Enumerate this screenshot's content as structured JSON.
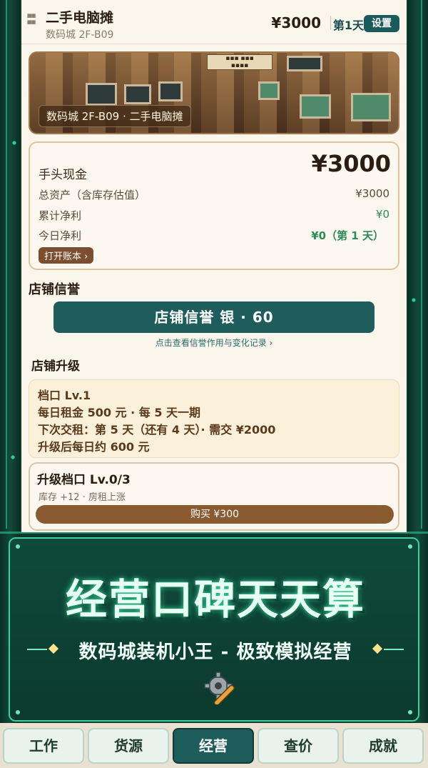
{
  "header": {
    "title": "二手电脑摊",
    "location": "数码城 2F-B09",
    "cash": "¥3000",
    "day": "第1天",
    "settings_label": "设置"
  },
  "banner": {
    "caption": "数码城 2F-B09 · 二手电脑摊"
  },
  "finance": {
    "cash_label": "手头现金",
    "cash_value": "¥3000",
    "total_assets_label": "总资产（含库存估值）",
    "total_assets_value": "¥3000",
    "cumulative_profit_label": "累计净利",
    "cumulative_profit_value": "¥0",
    "today_profit_label": "今日净利",
    "today_profit_value": "¥0（第 1 天）",
    "ledger_button": "打开账本 ›"
  },
  "reputation": {
    "section_title": "店铺信誉",
    "bar_text": "店铺信誉  银 · 60",
    "link_text": "点击查看信誉作用与变化记录 ›"
  },
  "upgrade": {
    "section_title": "店铺升级",
    "stall_level": "档口 Lv.1",
    "daily_rent": "每日租金 500 元 · 每 5 天一期",
    "next_payment": "下次交租：第 5 天（还有 4 天）· 需交 ¥2000",
    "after_upgrade": "升级后每日约 600 元",
    "card_title": "升级档口 Lv.0/3",
    "card_desc": "库存 +12 · 房租上涨",
    "buy_button": "购买 ¥300"
  },
  "promo": {
    "title": "经营口碑天天算",
    "subtitle": "数码城装机小王 - 极致模拟经营",
    "icon": "gear-wrench-icon"
  },
  "tabs": [
    {
      "label": "工作"
    },
    {
      "label": "货源"
    },
    {
      "label": "经营"
    },
    {
      "label": "查价"
    },
    {
      "label": "成就"
    }
  ],
  "colors": {
    "accent": "#1f5c5c",
    "frame": "#0d3a2e",
    "positive": "#2c8a5a",
    "paper": "#fbf6ec"
  }
}
